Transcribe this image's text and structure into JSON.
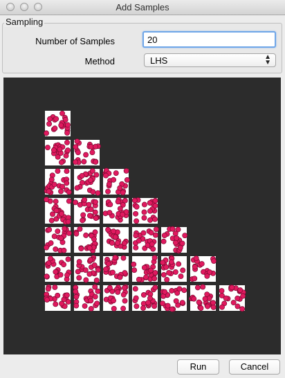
{
  "window": {
    "title": "Add Samples"
  },
  "sampling": {
    "group_label": "Sampling",
    "num_samples_label": "Number of Samples",
    "num_samples_value": "20",
    "method_label": "Method",
    "method_value": "LHS"
  },
  "buttons": {
    "run": "Run",
    "cancel": "Cancel"
  },
  "colors": {
    "point": "#e0195f",
    "cell_bg": "#ffffff",
    "canvas_bg": "#2c2c2c"
  },
  "scatter_matrix": {
    "dimensions": 7,
    "samples_per_cell": 20
  }
}
